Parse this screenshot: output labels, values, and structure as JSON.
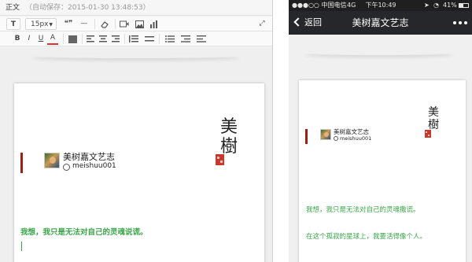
{
  "editor": {
    "header": {
      "label": "正文",
      "autosave": "（自动保存：2015-01-30 13:48:53）"
    },
    "toolbar": {
      "font_size": "15px",
      "text_tool": "T",
      "quote_glyph": "❝❞",
      "hr_glyph": "—",
      "bold": "B",
      "italic": "I",
      "underline": "U",
      "color": "A",
      "expand_glyph": "⤢"
    },
    "article": {
      "logo_line1": "美",
      "logo_line2": "樹",
      "account_name": "美树嘉文艺志",
      "account_id": "meishuu001",
      "body_text": "我想，我只是无法对自己的灵魂说谎。"
    }
  },
  "phone": {
    "status": {
      "carrier": "●●●○○ 中国电信",
      "network": "4G",
      "time": "下午10:49",
      "battery": "41%"
    },
    "nav": {
      "back_label": "返回",
      "title": "美树嘉文艺志"
    },
    "article": {
      "logo_line1": "美",
      "logo_line2": "樹",
      "account_name": "美树嘉文艺志",
      "account_id": "meishuu001",
      "line1": "我想，我只是无法对自己的灵魂撒谎。",
      "line2": "在这个孤寂的星球上，我要活得像个人。"
    }
  },
  "colors": {
    "accent_green": "#3ba64a",
    "accent_red": "#9e1f14",
    "seal_red": "#c8392b",
    "nav_dark": "#26272b"
  },
  "icons": [
    "text-format-icon",
    "quote-icon",
    "horizontal-rule-icon",
    "eraser-icon",
    "video-icon",
    "image-icon",
    "chart-icon",
    "fullscreen-icon",
    "align-left-icon",
    "align-center-icon",
    "align-right-icon",
    "list-icon",
    "back-arrow-icon",
    "more-icon",
    "wechat-icon",
    "seal-icon"
  ]
}
